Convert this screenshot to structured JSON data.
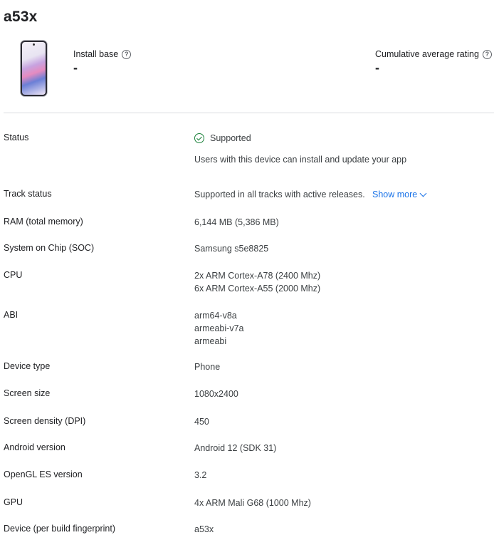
{
  "device_title": "a53x",
  "stats": {
    "install_base_label": "Install base",
    "install_base_value": "-",
    "rating_label": "Cumulative average rating",
    "rating_value": "-"
  },
  "rows": {
    "status": {
      "label": "Status",
      "value": "Supported",
      "subtext": "Users with this device can install and update your app"
    },
    "track_status": {
      "label": "Track status",
      "value": "Supported in all tracks with active releases.",
      "link": "Show more"
    },
    "ram": {
      "label": "RAM (total memory)",
      "value": "6,144 MB (5,386 MB)"
    },
    "soc": {
      "label": "System on Chip (SOC)",
      "value": "Samsung s5e8825"
    },
    "cpu": {
      "label": "CPU",
      "values": [
        "2x ARM Cortex-A78 (2400 Mhz)",
        "6x ARM Cortex-A55 (2000 Mhz)"
      ]
    },
    "abi": {
      "label": "ABI",
      "values": [
        "arm64-v8a",
        "armeabi-v7a",
        "armeabi"
      ]
    },
    "device_type": {
      "label": "Device type",
      "value": "Phone"
    },
    "screen_size": {
      "label": "Screen size",
      "value": "1080x2400"
    },
    "density": {
      "label": "Screen density (DPI)",
      "value": "450"
    },
    "android": {
      "label": "Android version",
      "value": "Android 12 (SDK 31)"
    },
    "opengl": {
      "label": "OpenGL ES version",
      "value": "3.2"
    },
    "gpu": {
      "label": "GPU",
      "value": "4x ARM Mali G68 (1000 Mhz)"
    },
    "fingerprint": {
      "label": "Device (per build fingerprint)",
      "value": "a53x"
    }
  },
  "colors": {
    "supported": "#188038",
    "link": "#1a73e8",
    "divider": "#dadce0"
  },
  "icons": {
    "help": "help-circle-icon",
    "status": "check-circle-icon",
    "show_more": "chevron-down-icon"
  }
}
